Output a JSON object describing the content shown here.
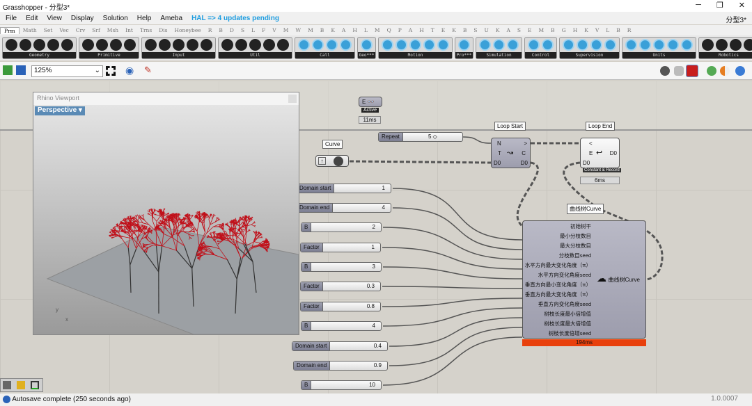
{
  "window": {
    "title": "Grasshopper - 分型3*",
    "doc_name": "分型3*",
    "controls": [
      "─",
      "❐",
      "✕"
    ]
  },
  "menu": {
    "items": [
      "File",
      "Edit",
      "View",
      "Display",
      "Solution",
      "Help",
      "Ameba"
    ],
    "hal": "HAL => 4 updates pending"
  },
  "tabs": [
    "Prm",
    "Math",
    "Set",
    "Vec",
    "Crv",
    "Srf",
    "Msh",
    "Int",
    "Trns",
    "Dis",
    "Honeybee",
    "R",
    "B",
    "D",
    "S",
    "L",
    "F",
    "V",
    "M",
    "W",
    "M",
    "B",
    "K",
    "A",
    "H",
    "L",
    "M",
    "Q",
    "P",
    "A",
    "H",
    "T",
    "E",
    "K",
    "B",
    "S",
    "U",
    "K",
    "A",
    "S",
    "E",
    "M",
    "B",
    "G",
    "H",
    "K",
    "V",
    "L",
    "B",
    "R"
  ],
  "ribbon_groups": [
    {
      "label": "Geometry",
      "n": 5,
      "color": "dark"
    },
    {
      "label": "Primitive",
      "n": 4,
      "color": "dark"
    },
    {
      "label": "Input",
      "n": 5,
      "color": "dark"
    },
    {
      "label": "Util",
      "n": 5,
      "color": "dark"
    },
    {
      "label": "Call",
      "n": 4,
      "color": "blue"
    },
    {
      "label": "Geo***",
      "n": 1,
      "color": "blue"
    },
    {
      "label": "Motion",
      "n": 5,
      "color": "blue"
    },
    {
      "label": "Pro***",
      "n": 1,
      "color": "blue"
    },
    {
      "label": "Simulation",
      "n": 3,
      "color": "blue"
    },
    {
      "label": "Control",
      "n": 2,
      "color": "blue"
    },
    {
      "label": "Supervision",
      "n": 4,
      "color": "blue"
    },
    {
      "label": "Units",
      "n": 5,
      "color": "blue"
    },
    {
      "label": "Robotics",
      "n": 4,
      "color": "dark"
    }
  ],
  "toolbar": {
    "zoom": "125%"
  },
  "viewport": {
    "title": "Rhino Viewport",
    "view": "Perspective",
    "axis_x": "x",
    "axis_y": "y"
  },
  "canvas": {
    "data_dam": {
      "input": "E",
      "tag": "Active",
      "time": "11ms"
    },
    "curve_param": {
      "tag": "Curve"
    },
    "repeat": {
      "name": "Repeat",
      "value": "5"
    },
    "loop_start": {
      "tag": "Loop Start",
      "inputs": [
        "N",
        "T",
        "D0"
      ],
      "outputs": [
        ">",
        "C",
        "D0"
      ]
    },
    "loop_end": {
      "tag": "Loop End",
      "inputs": [
        "<",
        "E",
        "D0"
      ],
      "output": "D0",
      "mode": "Constant & Record",
      "time": "6ms"
    },
    "sliders": [
      {
        "name": "Domain start",
        "value": "1"
      },
      {
        "name": "Domain end",
        "value": "4"
      },
      {
        "name": "B",
        "value": "2"
      },
      {
        "name": "Factor",
        "value": "1"
      },
      {
        "name": "B",
        "value": "3"
      },
      {
        "name": "Factor",
        "value": "0.3"
      },
      {
        "name": "Factor",
        "value": "0.8"
      },
      {
        "name": "B",
        "value": "4"
      },
      {
        "name": "Domain start",
        "value": "0.4"
      },
      {
        "name": "Domain end",
        "value": "0.9"
      },
      {
        "name": "B",
        "value": "10"
      }
    ],
    "tree_component": {
      "tag": "曲线树Curve",
      "inputs": [
        "初始树干",
        "最小分枝数目",
        "最大分枝数目",
        "分枝数目seed",
        "水平方向最大变化角度（π）",
        "水平方向变化角度seed",
        "垂直方向最小变化角度（π）",
        "垂直方向最大变化角度（π）",
        "垂直方向变化角度seed",
        "树枝长度最小倍增值",
        "树枝长度最大倍增值",
        "树枝长度倍增seed"
      ],
      "output": "曲线树Curve",
      "time": "194ms",
      "time_color": "#e8400c"
    }
  },
  "status": {
    "message": "Autosave complete (250 seconds ago)",
    "version": "1.0.0007"
  }
}
